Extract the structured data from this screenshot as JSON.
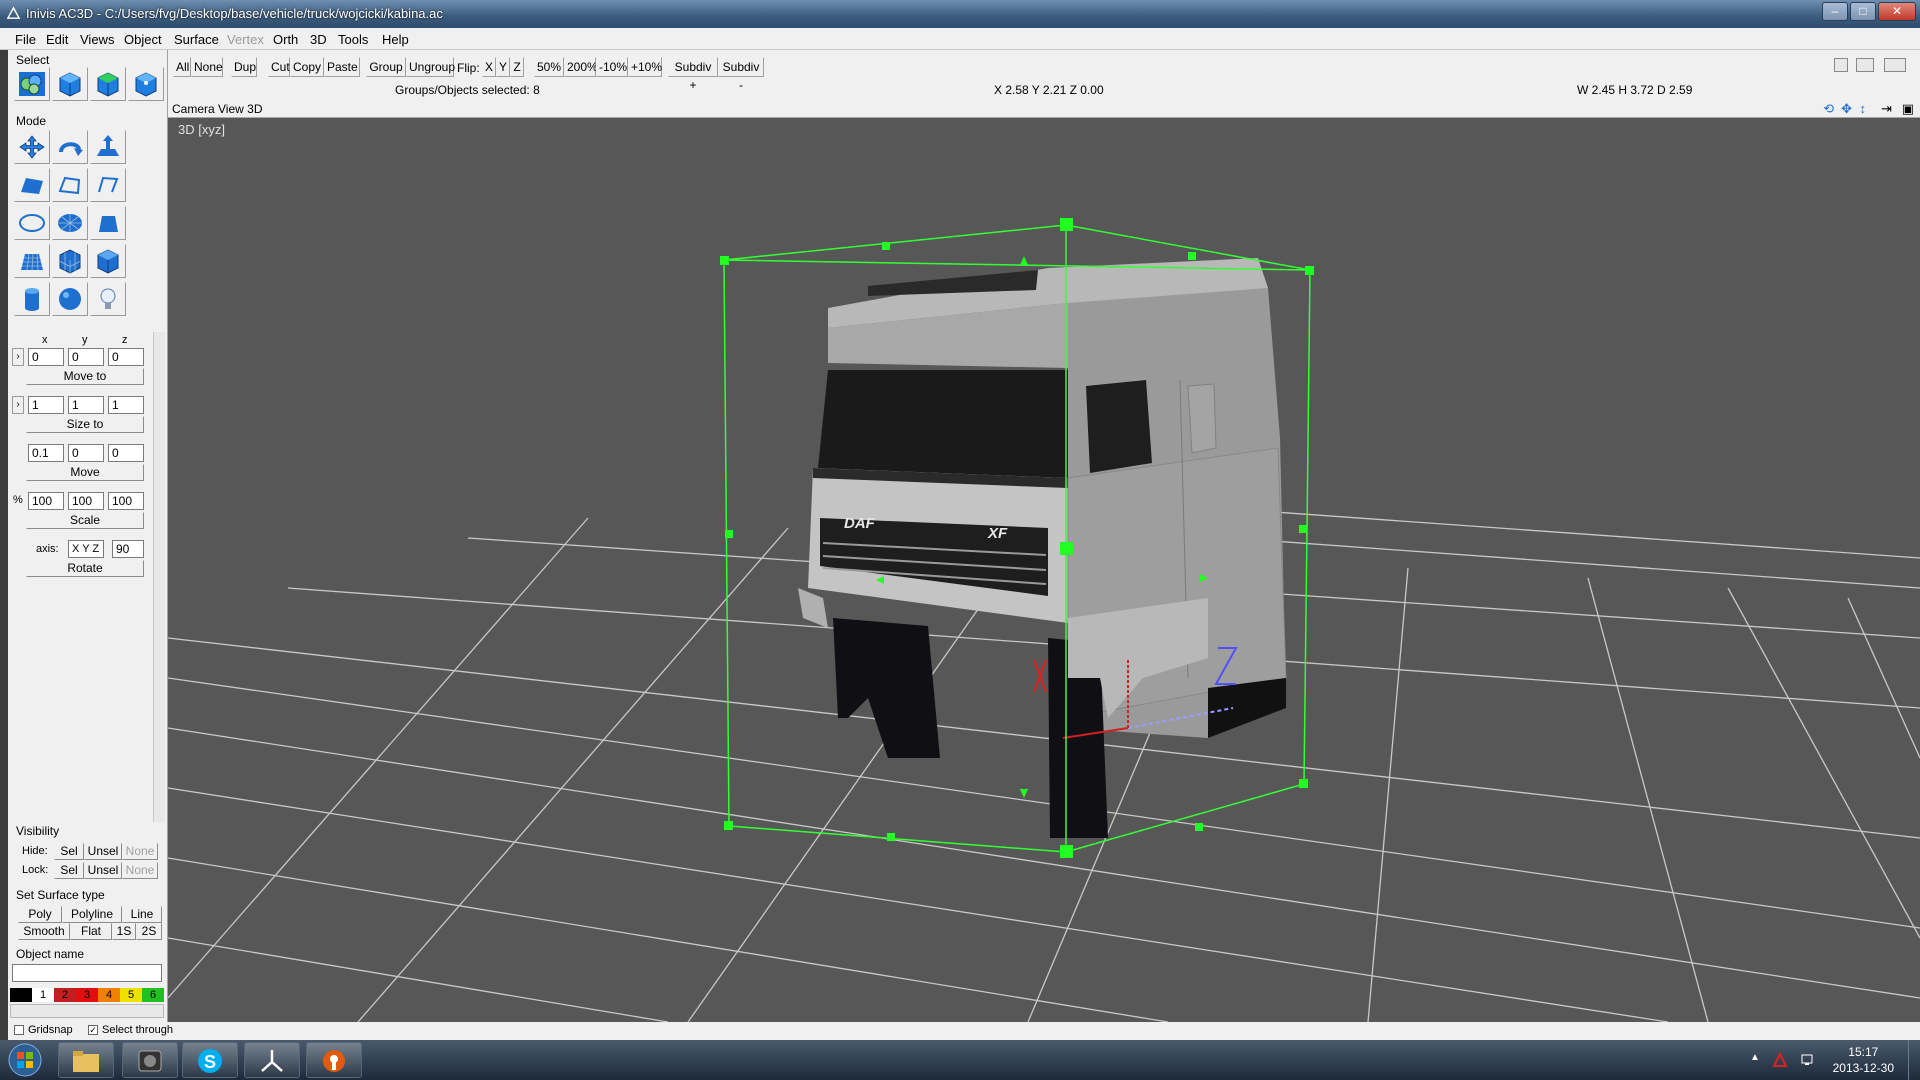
{
  "window": {
    "title": "Inivis AC3D - C:/Users/fvg/Desktop/base/vehicle/truck/wojcicki/kabina.ac",
    "minimize_label": "–",
    "maximize_label": "□",
    "close_label": "✕"
  },
  "menu": [
    "File",
    "Edit",
    "Views",
    "Object",
    "Surface",
    "Vertex",
    "Orth",
    "3D",
    "Tools",
    "Help"
  ],
  "toolbar": {
    "all": "All",
    "none": "None",
    "dup": "Dup",
    "cut": "Cut",
    "copy": "Copy",
    "paste": "Paste",
    "group": "Group",
    "ungroup": "Ungroup",
    "flip_label": "Flip:",
    "flip_x": "X",
    "flip_y": "Y",
    "flip_z": "Z",
    "zoom_50": "50%",
    "zoom_200": "200%",
    "zoom_minus10": "-10%",
    "zoom_plus10": "+10%",
    "subdiv_plus": "Subdiv +",
    "subdiv_minus": "Subdiv -"
  },
  "status": {
    "selected": "Groups/Objects selected: 8",
    "coords": "X 2.58 Y 2.21 Z 0.00",
    "dims": "W 2.45 H 3.72 D 2.59"
  },
  "viewport": {
    "header": "Camera  View  3D",
    "label": "3D [xyz]",
    "bg_color": "#575757",
    "grid_color": "#c8c8c8",
    "bbox_color": "#33ff33",
    "truck_brand": "DAF",
    "truck_model": "XF",
    "axis_z_label": "Z"
  },
  "left": {
    "select_label": "Select",
    "mode_label": "Mode",
    "axis_headers": [
      "x",
      "y",
      "z"
    ],
    "move_to": {
      "values": [
        "0",
        "0",
        "0"
      ],
      "button": "Move to"
    },
    "size_to": {
      "values": [
        "1",
        "1",
        "1"
      ],
      "button": "Size to"
    },
    "move": {
      "values": [
        "0.1",
        "0",
        "0"
      ],
      "button": "Move"
    },
    "scale": {
      "prefix": "%",
      "values": [
        "100",
        "100",
        "100"
      ],
      "button": "Scale"
    },
    "rotate": {
      "axis_label": "axis:",
      "axes": "X Y Z",
      "angle": "90",
      "button": "Rotate"
    },
    "visibility_label": "Visibility",
    "hide_label": "Hide:",
    "lock_label": "Lock:",
    "sel": "Sel",
    "unsel": "Unsel",
    "none": "None",
    "surface_label": "Set Surface type",
    "poly": "Poly",
    "polyline": "Polyline",
    "line": "Line",
    "smooth": "Smooth",
    "flat": "Flat",
    "one_s": "1S",
    "two_s": "2S",
    "object_name_label": "Object name",
    "object_name_value": "",
    "swatches": [
      {
        "label": "",
        "color": "#000000"
      },
      {
        "label": "1",
        "color": "#ffffff"
      },
      {
        "label": "2",
        "color": "#c02020"
      },
      {
        "label": "3",
        "color": "#e01010"
      },
      {
        "label": "4",
        "color": "#f08000"
      },
      {
        "label": "5",
        "color": "#f0e000"
      },
      {
        "label": "6",
        "color": "#20c020"
      }
    ],
    "gridsnap": "Gridsnap",
    "select_through": "Select through"
  },
  "taskbar": {
    "time": "15:17",
    "date": "2013-12-30"
  }
}
